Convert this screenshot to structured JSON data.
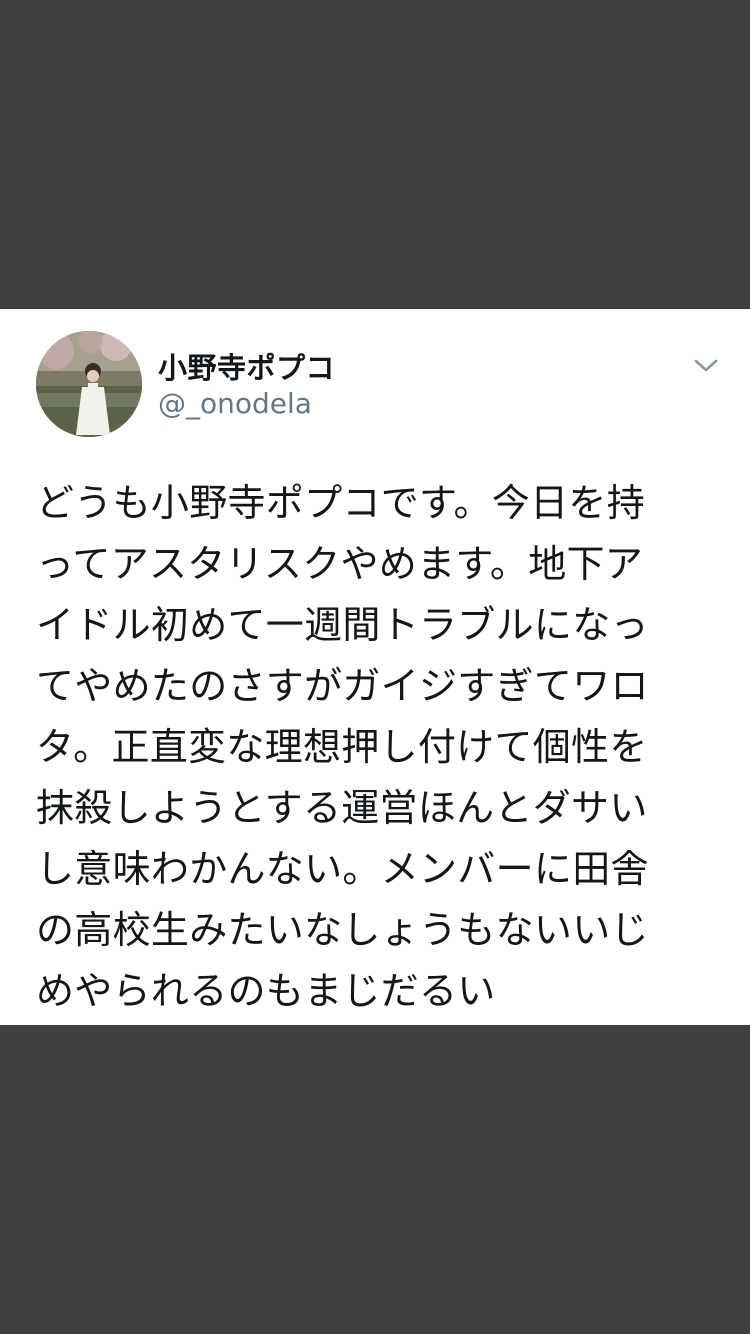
{
  "tweet": {
    "display_name": "小野寺ポプコ",
    "handle": "@_onodela",
    "avatar_icon": "user-avatar-photo",
    "menu_icon": "chevron-down-icon",
    "body_lines": [
      "どうも小野寺ポプコです。今日を持",
      "ってアスタリスクやめます。地下ア",
      "イドル初めて一週間トラブルになっ",
      "てやめたのさすがガイジすぎてワロ",
      "タ。正直変な理想押し付けて個性を",
      "抹殺しようとする運営ほんとダサい",
      "し意味わかんない。メンバーに田舎",
      "の高校生みたいなしょうもないいじ",
      "めやられるのもまじだるい"
    ]
  },
  "colors": {
    "background": "#3f3f3f",
    "card": "#ffffff",
    "text": "#14171a",
    "secondary_text": "#657786"
  }
}
